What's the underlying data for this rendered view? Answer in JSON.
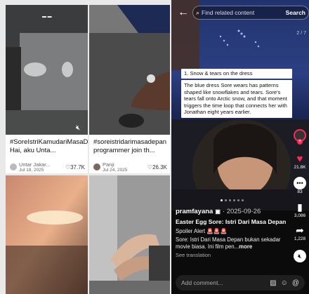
{
  "grid": {
    "cards": [
      {
        "caption": "#SoreIstriKamudariMasaDepan Hai, aku Unta...",
        "author": "Untar Jakar...",
        "date": "Jul 18, 2025",
        "likes": "37.7K"
      },
      {
        "caption": "#soreistridarimasadepan programmer join th...",
        "author": "Panji",
        "date": "Jul 24, 2025",
        "likes": "26.3K"
      },
      {
        "caption": "",
        "author": "",
        "date": "",
        "likes": ""
      },
      {
        "caption": "",
        "author": "",
        "date": "",
        "likes": ""
      }
    ],
    "mute_icon": "speaker-mute-icon"
  },
  "player": {
    "search_placeholder": "Find related content",
    "search_button": "Search",
    "pager": "2 / 7",
    "note_title": "1. Snow & tears on the dress",
    "note_body": "The blue dress Sore wears has patterns shaped like snowflakes and tears. Sore's tears fall onto Arctic snow, and that moment triggers the time loop that connects her with Jonathan eight years earlier.",
    "username": "pramfayana",
    "date": "· 2025-09-26",
    "video_title": "Easter Egg Sore: Istri Dari Masa Depan",
    "spoiler": "Spoiler Alert 🚨🚨🚨",
    "description": "Sore: Istri Dari Masa Depan bukan sekadar movie biasa. Ini film pen...",
    "more": "more",
    "see_translation": "See translation",
    "comment_placeholder": "Add comment...",
    "side": {
      "likes": "21.8K",
      "comments": "83",
      "saves": "3,086",
      "shares": "1,228"
    }
  }
}
